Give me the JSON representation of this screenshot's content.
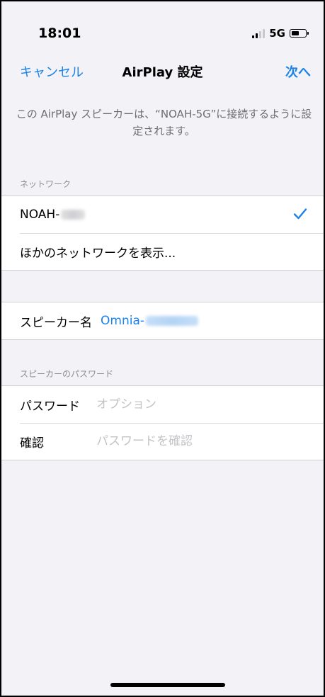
{
  "status_bar": {
    "time": "18:01",
    "network": "5G",
    "icons": [
      "signal-icon",
      "battery-icon"
    ]
  },
  "nav": {
    "cancel_label": "キャンセル",
    "title": "AirPlay 設定",
    "next_label": "次へ"
  },
  "description": "この AirPlay スピーカーは、“NOAH-5G”に接続するように設定されます。",
  "network_section": {
    "header": "ネットワーク",
    "selected_network": "NOAH-",
    "other_networks_label": "ほかのネットワークを表示..."
  },
  "speaker": {
    "label": "スピーカー名",
    "value": "Omnia-"
  },
  "password_section": {
    "header": "スピーカーのパスワード",
    "password_label": "パスワード",
    "password_placeholder": "オプション",
    "confirm_label": "確認",
    "confirm_placeholder": "パスワードを確認"
  },
  "colors": {
    "accent": "#1a82ea",
    "background": "#f2f2f7",
    "secondary_text": "#6d6d72"
  }
}
